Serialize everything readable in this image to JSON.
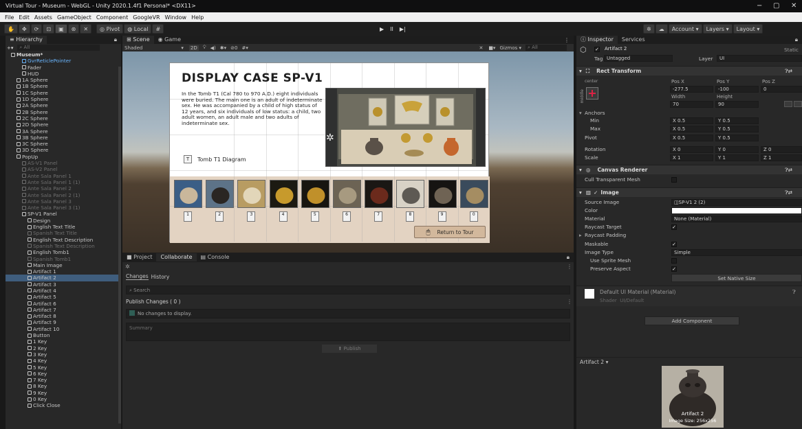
{
  "window": {
    "title": "Virtual Tour - Museum - WebGL - Unity 2020.1.4f1 Personal* <DX11>",
    "minimize": "−",
    "maximize": "▢",
    "close": "✕"
  },
  "menu": [
    "File",
    "Edit",
    "Assets",
    "GameObject",
    "Component",
    "GoogleVR",
    "Window",
    "Help"
  ],
  "toolbar": {
    "pivot": "Pivot",
    "local": "Local",
    "play": "▶",
    "pause": "II",
    "step": "▶|",
    "account": "Account",
    "layers": "Layers",
    "layout": "Layout"
  },
  "hierarchy": {
    "tab": "Hierarchy",
    "search": "All",
    "items": [
      {
        "label": "Museum*",
        "indent": 1,
        "style": "scene"
      },
      {
        "label": "GvrReticlePointer",
        "indent": 3,
        "style": "blue"
      },
      {
        "label": "Fader",
        "indent": 3,
        "style": ""
      },
      {
        "label": "HUD",
        "indent": 3,
        "style": ""
      },
      {
        "label": "1A Sphere",
        "indent": 2,
        "style": ""
      },
      {
        "label": "1B Sphere",
        "indent": 2,
        "style": ""
      },
      {
        "label": "1C Sphere",
        "indent": 2,
        "style": ""
      },
      {
        "label": "1D Sphere",
        "indent": 2,
        "style": ""
      },
      {
        "label": "2A Sphere",
        "indent": 2,
        "style": ""
      },
      {
        "label": "2B Sphere",
        "indent": 2,
        "style": ""
      },
      {
        "label": "2C Sphere",
        "indent": 2,
        "style": ""
      },
      {
        "label": "2D Sphere",
        "indent": 2,
        "style": ""
      },
      {
        "label": "3A Sphere",
        "indent": 2,
        "style": ""
      },
      {
        "label": "3B Sphere",
        "indent": 2,
        "style": ""
      },
      {
        "label": "3C Sphere",
        "indent": 2,
        "style": ""
      },
      {
        "label": "3D Sphere",
        "indent": 2,
        "style": ""
      },
      {
        "label": "PopUp",
        "indent": 2,
        "style": ""
      },
      {
        "label": "AS-V1 Panel",
        "indent": 3,
        "style": "dim"
      },
      {
        "label": "AS-V2 Panel",
        "indent": 3,
        "style": "dim"
      },
      {
        "label": "Ante Sala Panel 1",
        "indent": 3,
        "style": "dim"
      },
      {
        "label": "Ante Sala Panel 1 (1)",
        "indent": 3,
        "style": "dim"
      },
      {
        "label": "Ante Sala Panel 2",
        "indent": 3,
        "style": "dim"
      },
      {
        "label": "Ante Sala Panel 2 (1)",
        "indent": 3,
        "style": "dim"
      },
      {
        "label": "Ante Sala Panel 3",
        "indent": 3,
        "style": "dim"
      },
      {
        "label": "Ante Sala Panel 3 (1)",
        "indent": 3,
        "style": "dim"
      },
      {
        "label": "SP-V1 Panel",
        "indent": 3,
        "style": ""
      },
      {
        "label": "Design",
        "indent": 4,
        "style": ""
      },
      {
        "label": "English Text Title",
        "indent": 4,
        "style": ""
      },
      {
        "label": "Spanish Text Title",
        "indent": 4,
        "style": "dim"
      },
      {
        "label": "English Text Description",
        "indent": 4,
        "style": ""
      },
      {
        "label": "Spanish Text Description",
        "indent": 4,
        "style": "dim"
      },
      {
        "label": "English Tomb1",
        "indent": 4,
        "style": ""
      },
      {
        "label": "Spanish Tomb1",
        "indent": 4,
        "style": "dim"
      },
      {
        "label": "Main Image",
        "indent": 4,
        "style": ""
      },
      {
        "label": "Artifact 1",
        "indent": 4,
        "style": ""
      },
      {
        "label": "Artifact 2",
        "indent": 4,
        "style": "sel"
      },
      {
        "label": "Artifact 3",
        "indent": 4,
        "style": ""
      },
      {
        "label": "Artifact 4",
        "indent": 4,
        "style": ""
      },
      {
        "label": "Artifact 5",
        "indent": 4,
        "style": ""
      },
      {
        "label": "Artifact 6",
        "indent": 4,
        "style": ""
      },
      {
        "label": "Artifact 7",
        "indent": 4,
        "style": ""
      },
      {
        "label": "Artifact 8",
        "indent": 4,
        "style": ""
      },
      {
        "label": "Artifact 9",
        "indent": 4,
        "style": ""
      },
      {
        "label": "Artifact 10",
        "indent": 4,
        "style": ""
      },
      {
        "label": "Button",
        "indent": 4,
        "style": ""
      },
      {
        "label": "1 Key",
        "indent": 4,
        "style": ""
      },
      {
        "label": "2 Key",
        "indent": 4,
        "style": ""
      },
      {
        "label": "3 Key",
        "indent": 4,
        "style": ""
      },
      {
        "label": "4 Key",
        "indent": 4,
        "style": ""
      },
      {
        "label": "5 Key",
        "indent": 4,
        "style": ""
      },
      {
        "label": "6 Key",
        "indent": 4,
        "style": ""
      },
      {
        "label": "7 Key",
        "indent": 4,
        "style": ""
      },
      {
        "label": "8 Key",
        "indent": 4,
        "style": ""
      },
      {
        "label": "9 Key",
        "indent": 4,
        "style": ""
      },
      {
        "label": "0 Key",
        "indent": 4,
        "style": ""
      },
      {
        "label": "Click Close",
        "indent": 4,
        "style": ""
      }
    ]
  },
  "scene": {
    "tabs": [
      "Scene",
      "Game"
    ],
    "shading": "Shaded",
    "mode2d": "2D",
    "gizmos": "Gizmos",
    "search": "All"
  },
  "panel": {
    "title": "DISPLAY CASE SP-V1",
    "description": "In the Tomb T1 (Cal 780 to 970 A.D.) eight individuals were buried. The main one is an adult of indeterminate sex. He was accompanied by a child of high status of 12 years, and six individuals of low status: a child, two adult women, an adult male and two adults of indeterminate sex.",
    "diagram_label": "Tomb T1 Diagram",
    "diagram_badge": "T",
    "return_label": "Return to Tour",
    "keys": [
      "1",
      "2",
      "3",
      "4",
      "5",
      "6",
      "7",
      "8",
      "9",
      "0"
    ]
  },
  "project": {
    "tabs": [
      "Project",
      "Collaborate",
      "Console"
    ],
    "subtabs": [
      "Changes",
      "History"
    ],
    "search": "Search",
    "publish_changes": "Publish Changes ( 0 )",
    "no_changes": "No changes to display.",
    "summary": "Summary",
    "publish": "Publish"
  },
  "inspector": {
    "tabs": [
      "Inspector",
      "Services"
    ],
    "object_name": "Artifact 2",
    "static": "Static",
    "tag_label": "Tag",
    "tag": "Untagged",
    "layer_label": "Layer",
    "layer": "UI",
    "rect_transform": "Rect Transform",
    "anchor_preset": "center",
    "anchor_side": "middle",
    "pos_x_label": "Pos X",
    "pos_x": "-277.5",
    "pos_y_label": "Pos Y",
    "pos_y": "-100",
    "pos_z_label": "Pos Z",
    "pos_z": "0",
    "width_label": "Width",
    "width": "70",
    "height_label": "Height",
    "height": "90",
    "anchors": "Anchors",
    "min": "Min",
    "max": "Max",
    "pivot": "Pivot",
    "rotation": "Rotation",
    "scale": "Scale",
    "x_label": "X",
    "y_label": "Y",
    "z_label": "Z",
    "anchor_min_x": "0.5",
    "anchor_min_y": "0.5",
    "anchor_max_x": "0.5",
    "anchor_max_y": "0.5",
    "pivot_x": "0.5",
    "pivot_y": "0.5",
    "rot_x": "0",
    "rot_y": "0",
    "rot_z": "0",
    "scale_x": "1",
    "scale_y": "1",
    "scale_z": "1",
    "canvas_renderer": "Canvas Renderer",
    "cull": "Cull Transparent Mesh",
    "image": "Image",
    "source_image_label": "Source Image",
    "source_image": "SP-V1 2 (2)",
    "color_label": "Color",
    "material_label": "Material",
    "material": "None (Material)",
    "raycast_target": "Raycast Target",
    "raycast_padding": "Raycast Padding",
    "maskable": "Maskable",
    "image_type_label": "Image Type",
    "image_type": "Simple",
    "use_sprite_mesh": "Use Sprite Mesh",
    "preserve_aspect": "Preserve Aspect",
    "set_native_size": "Set Native Size",
    "default_material": "Default UI Material (Material)",
    "shader_label": "Shader",
    "shader": "UI/Default",
    "add_component": "Add Component",
    "preview_title": "Artifact 2",
    "preview_name": "Artifact 2",
    "preview_size": "Image Size: 256x256"
  },
  "colors": {
    "editor_bg": "#282828",
    "selection": "#3f5d7d",
    "accent_blue": "#6ab6ff",
    "panel_beige": "#e3d3c2",
    "button_tan": "#d2b89c"
  }
}
